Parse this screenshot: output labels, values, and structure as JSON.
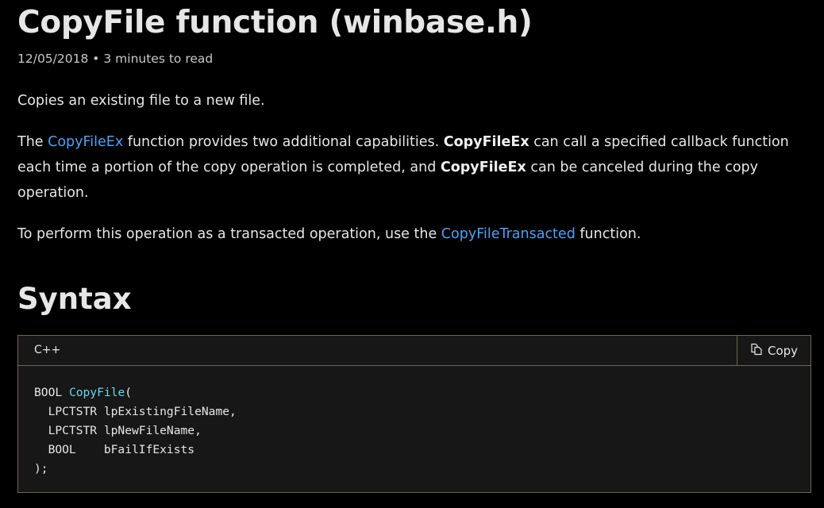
{
  "title": "CopyFile function (winbase.h)",
  "meta": {
    "date": "12/05/2018",
    "separator": "•",
    "read_time": "3 minutes to read"
  },
  "intro": "Copies an existing file to a new file.",
  "para2": {
    "t1": "The ",
    "link1": "CopyFileEx",
    "t2": " function provides two additional capabilities. ",
    "b1": "CopyFileEx",
    "t3": " can call a specified callback function each time a portion of the copy operation is completed, and ",
    "b2": "CopyFileEx",
    "t4": " can be canceled during the copy operation."
  },
  "para3": {
    "t1": "To perform this operation as a transacted operation, use the ",
    "link": "CopyFileTransacted",
    "t2": " function."
  },
  "syntax_heading": "Syntax",
  "code_block": {
    "language": "C++",
    "copy_label": "Copy",
    "lines": {
      "l1a": "BOOL ",
      "l1fn": "CopyFile",
      "l1b": "(",
      "l2": "  LPCTSTR lpExistingFileName,",
      "l3": "  LPCTSTR lpNewFileName,",
      "l4": "  BOOL    bFailIfExists",
      "l5": ");"
    }
  }
}
